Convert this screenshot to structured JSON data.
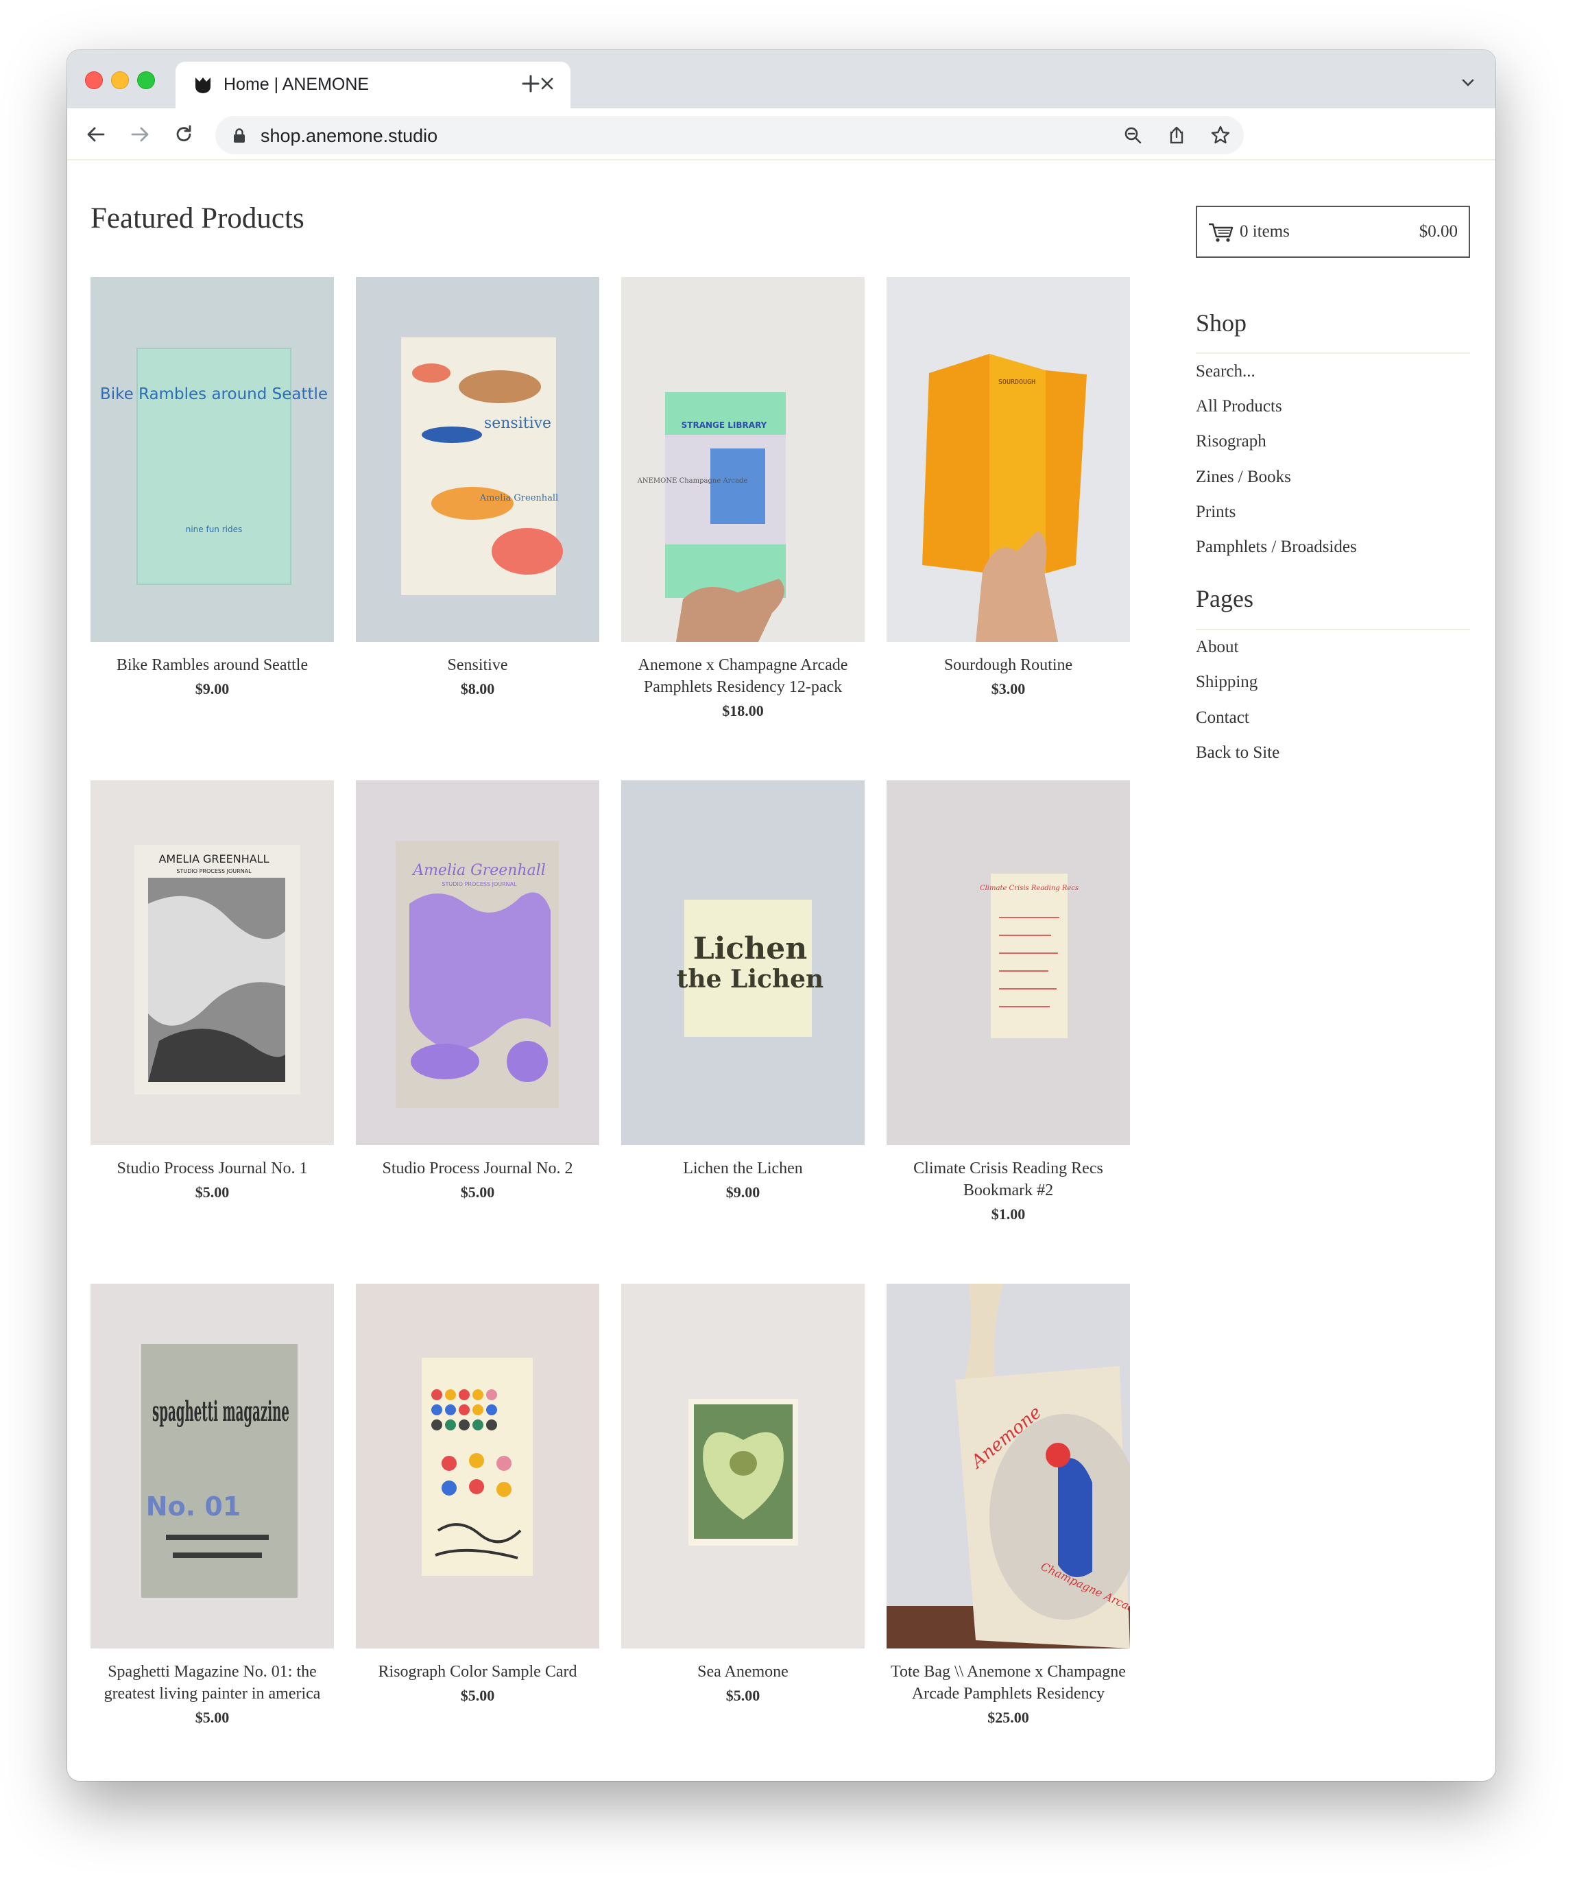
{
  "browser": {
    "tab_title": "Home | ANEMONE",
    "url": "shop.anemone.studio"
  },
  "page": {
    "title": "Featured Products"
  },
  "cart": {
    "items": "0 items",
    "total": "$0.00"
  },
  "sidebar": {
    "shop_heading": "Shop",
    "shop_links": [
      "Search...",
      "All Products",
      "Risograph",
      "Zines / Books",
      "Prints",
      "Pamphlets / Broadsides"
    ],
    "pages_heading": "Pages",
    "pages_links": [
      "About",
      "Shipping",
      "Contact",
      "Back to Site"
    ]
  },
  "products": [
    {
      "name": "Bike Rambles around Seattle",
      "price": "$9.00",
      "cover_title": "Bike Rambles around Seattle",
      "cover_sub": "nine fun rides"
    },
    {
      "name": "Sensitive",
      "price": "$8.00",
      "cover_title": "sensitive",
      "cover_sub": "Amelia Greenhall"
    },
    {
      "name": "Anemone x Champagne Arcade Pamphlets Residency 12-pack",
      "price": "$18.00",
      "cover_title": "STRANGE LIBRARY",
      "cover_sub": "ANEMONE Champagne Arcade"
    },
    {
      "name": "Sourdough Routine",
      "price": "$3.00",
      "cover_title": "SOURDOUGH",
      "cover_sub": ""
    },
    {
      "name": "Studio Process Journal No. 1",
      "price": "$5.00",
      "cover_title": "AMELIA GREENHALL",
      "cover_sub": "STUDIO PROCESS JOURNAL"
    },
    {
      "name": "Studio Process Journal No. 2",
      "price": "$5.00",
      "cover_title": "Amelia Greenhall",
      "cover_sub": "STUDIO PROCESS JOURNAL"
    },
    {
      "name": "Lichen the Lichen",
      "price": "$9.00",
      "cover_title": "Lichen",
      "cover_sub": "the Lichen"
    },
    {
      "name": "Climate Crisis Reading Recs Bookmark #2",
      "price": "$1.00",
      "cover_title": "Climate Crisis Reading Recs",
      "cover_sub": ""
    },
    {
      "name": "Spaghetti Magazine No. 01: the greatest living painter in america",
      "price": "$5.00",
      "cover_title": "spaghetti magazine",
      "cover_sub": "No. 01"
    },
    {
      "name": "Risograph Color Sample Card",
      "price": "$5.00",
      "cover_title": "",
      "cover_sub": ""
    },
    {
      "name": "Sea Anemone",
      "price": "$5.00",
      "cover_title": "",
      "cover_sub": ""
    },
    {
      "name": "Tote Bag \\\\ Anemone x Champagne Arcade Pamphlets Residency",
      "price": "$25.00",
      "cover_title": "Anemone",
      "cover_sub": "Champagne Arcade"
    }
  ],
  "colors": {
    "title_text": "#333333",
    "tab_bar": "#dee1e6",
    "omnibox": "#f1f3f4"
  }
}
